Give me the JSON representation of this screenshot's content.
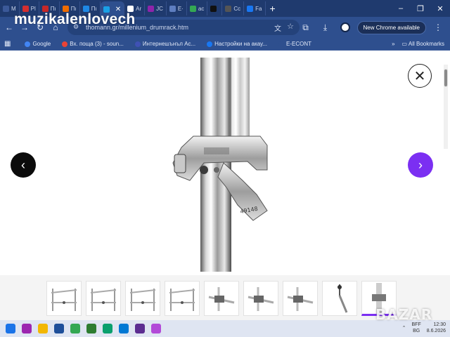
{
  "overlay": {
    "watermark": "muzikalenlovech",
    "corner_badge": "BAZAR"
  },
  "tabs": [
    {
      "label": "M",
      "color": "#3b5998"
    },
    {
      "label": "Pl",
      "color": "#d32f2f"
    },
    {
      "label": "Пı",
      "color": "#c62828"
    },
    {
      "label": "Пı",
      "color": "#ef6c00"
    },
    {
      "label": "Пı",
      "color": "#1e88e5"
    },
    {
      "label": "",
      "color": "#1aa0e6",
      "active": true
    },
    {
      "label": "Ar",
      "color": "#ffffff"
    },
    {
      "label": "JC",
      "color": "#8e24aa"
    },
    {
      "label": "E·",
      "color": "#5e7ec0"
    },
    {
      "label": "ac",
      "color": "#34a853"
    },
    {
      "label": "",
      "color": "#111111"
    },
    {
      "label": "Cc",
      "color": "#555555"
    },
    {
      "label": "Fa",
      "color": "#1877f2"
    }
  ],
  "toolbar": {
    "url": "thomann.gr/millenium_drumrack.htm",
    "new_chrome_label": "New Chrome available",
    "menu_icon": "⋮"
  },
  "bookmarks": {
    "items": [
      {
        "label": "Google",
        "color": "#4285f4"
      },
      {
        "label": "Вх. поща (3) - soun...",
        "color": "#ea4335"
      },
      {
        "label": "Интернешънъл Ас...",
        "color": "#3f51b5"
      },
      {
        "label": "Настройки на акау...",
        "color": "#1877f2"
      },
      {
        "label": "E-ECONT",
        "color": "#2e4f8e"
      }
    ],
    "more": "»",
    "all_label": "All Bookmarks"
  },
  "viewer": {
    "close_glyph": "✕",
    "prev_glyph": "‹",
    "next_glyph": "›",
    "product_text": "49148"
  },
  "thumbnails": [
    "drum-rack-front",
    "drum-rack-angle",
    "drum-rack-side",
    "drum-rack-back",
    "clamp-detail-1",
    "clamp-detail-2",
    "clamp-detail-3",
    "cymbal-arm",
    "clamp-on-tube"
  ],
  "taskbar": {
    "icons": [
      {
        "name": "windows-start-icon",
        "color": "#1a73e8"
      },
      {
        "name": "copilot-icon",
        "color": "#9c27b0"
      },
      {
        "name": "file-explorer-icon",
        "color": "#f2b705"
      },
      {
        "name": "media-icon",
        "color": "#1e4f9a"
      },
      {
        "name": "chrome-icon",
        "color": "#34a853"
      },
      {
        "name": "sheet-icon",
        "color": "#2e7d32"
      },
      {
        "name": "phone-link-icon",
        "color": "#0aa06e"
      },
      {
        "name": "edge-icon",
        "color": "#0078d4"
      },
      {
        "name": "store-icon",
        "color": "#5c2d91"
      },
      {
        "name": "app-icon",
        "color": "#b24ad8"
      }
    ],
    "lang_top": "BFF",
    "lang_bottom": "BG",
    "time": "12:30",
    "date": "8.6.2026"
  },
  "colors": {
    "accent": "#7b2ff2",
    "browser": "#2e4f8e"
  }
}
